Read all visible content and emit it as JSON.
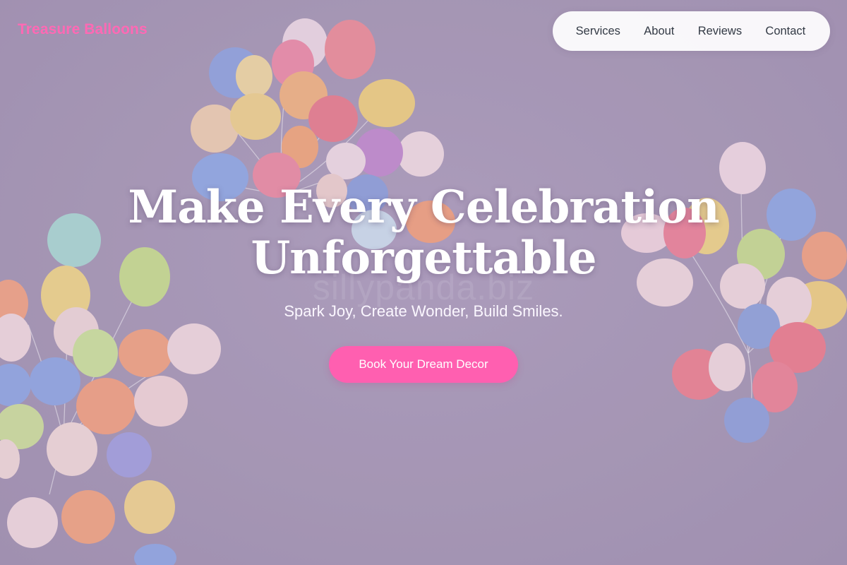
{
  "brand": {
    "name": "Treasure Balloons",
    "color": "#ff69b4"
  },
  "nav": {
    "items": [
      "Services",
      "About",
      "Reviews",
      "Contact"
    ]
  },
  "hero": {
    "title_line1": "Make Every Celebration",
    "title_line2": "Unforgettable",
    "watermark": "sillypanda.biz",
    "tagline": "Spark Joy, Create Wonder, Build Smiles.",
    "cta_label": "Book Your Dream Decor",
    "cta_color": "#ff5fb0",
    "background_color": "#a697b5"
  }
}
